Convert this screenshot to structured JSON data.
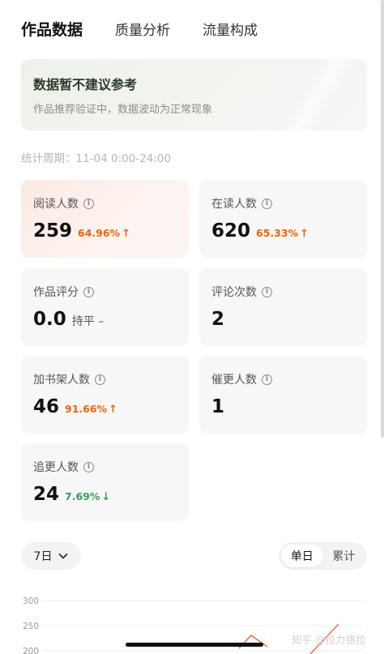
{
  "tabs": [
    {
      "label": "作品数据",
      "active": true
    },
    {
      "label": "质量分析",
      "active": false
    },
    {
      "label": "流量构成",
      "active": false
    }
  ],
  "notice": {
    "title": "数据暂不建议参考",
    "text": "作品推荐验证中，数据波动为正常现象"
  },
  "period": "统计周期：11-04 0:00-24:00",
  "cards": [
    {
      "label": "阅读人数",
      "value": "259",
      "change": "64.96%",
      "trend": "up",
      "arrow": "↑"
    },
    {
      "label": "在读人数",
      "value": "620",
      "change": "65.33%",
      "trend": "up",
      "arrow": "↑"
    },
    {
      "label": "作品评分",
      "value": "0.0",
      "flat": "持平 –"
    },
    {
      "label": "评论次数",
      "value": "2"
    },
    {
      "label": "加书架人数",
      "value": "46",
      "change": "91.66%",
      "trend": "up",
      "arrow": "↑"
    },
    {
      "label": "催更人数",
      "value": "1"
    },
    {
      "label": "追更人数",
      "value": "24",
      "change": "7.69%",
      "trend": "down",
      "arrow": "↓"
    }
  ],
  "range_select": {
    "value": "7日"
  },
  "segment": {
    "options": [
      "单日",
      "累计"
    ],
    "active": 0
  },
  "chart_axis": {
    "ticks": [
      "300",
      "250",
      "200"
    ]
  },
  "watermark": "知乎 @拉力铬拉",
  "colors": {
    "up": "#e8670d",
    "down": "#3a9a5a",
    "chart_line": "#ee6a4a"
  }
}
